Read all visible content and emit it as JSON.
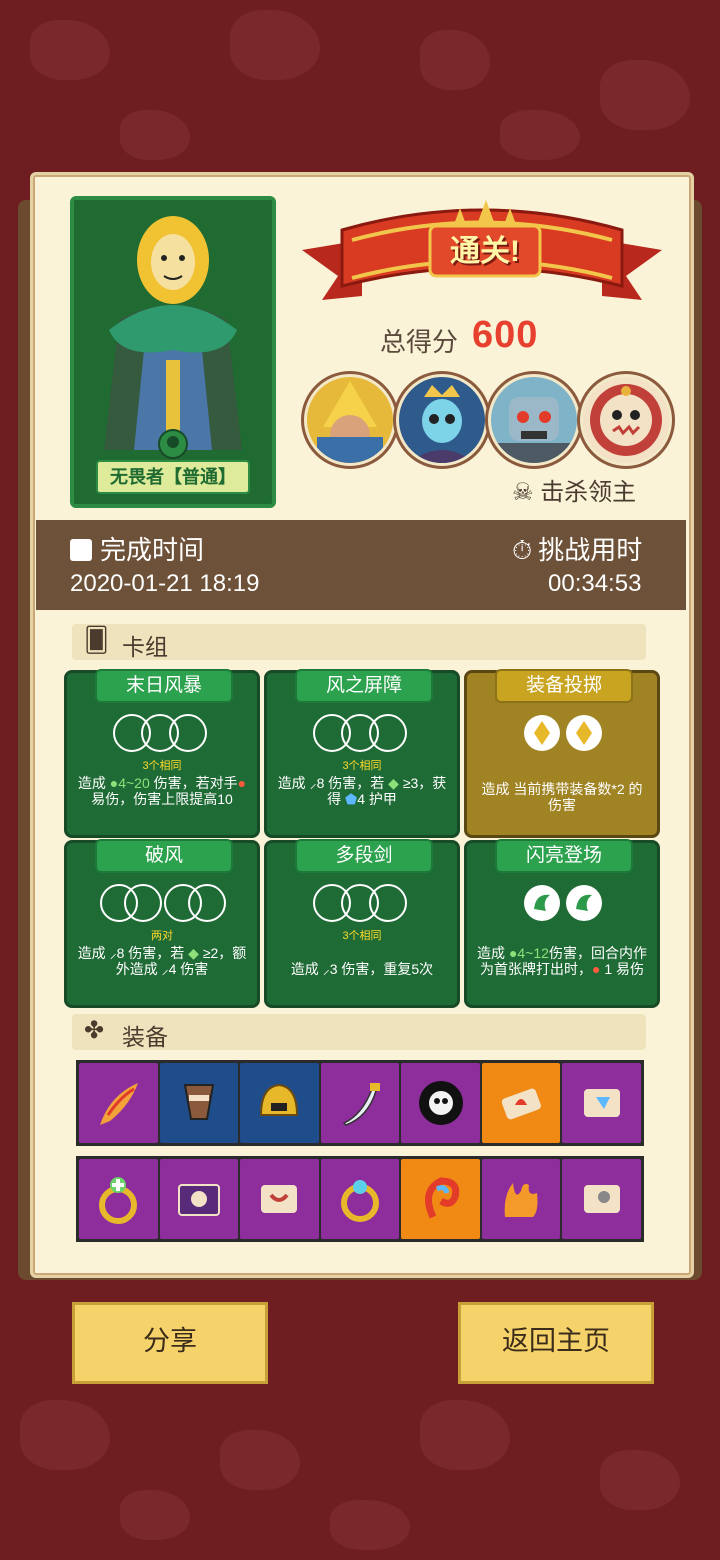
{
  "result": {
    "banner": "通关!",
    "score_label": "总得分",
    "score_value": "600",
    "kill_label": "击杀领主"
  },
  "hero": {
    "name": "无畏者【普通】"
  },
  "time": {
    "finish_label": "完成时间",
    "finish_value": "2020-01-21 18:19",
    "elapsed_label": "挑战用时",
    "elapsed_value": "00:34:53"
  },
  "deck": {
    "title": "卡组",
    "cards": [
      {
        "name": "末日风暴",
        "combo": "3个相同",
        "desc_a": "造成",
        "desc_b": "4~20",
        "desc_c": "伤害，若对手",
        "desc_d": "易伤，伤害上限提高10",
        "color": "green"
      },
      {
        "name": "风之屏障",
        "combo": "3个相同",
        "desc_a": "造成",
        "desc_b": "8 伤害，若",
        "desc_c": "≥3，获得",
        "desc_d": "4 护甲",
        "color": "green"
      },
      {
        "name": "装备投掷",
        "combo": "",
        "desc_a": "造成 当前携带装备数*2 的伤害",
        "desc_b": "",
        "desc_c": "",
        "desc_d": "",
        "color": "yellow"
      },
      {
        "name": "破风",
        "combo": "两对",
        "desc_a": "造成",
        "desc_b": "8 伤害，若",
        "desc_c": "≥2，额外造成",
        "desc_d": "4 伤害",
        "color": "green"
      },
      {
        "name": "多段剑",
        "combo": "3个相同",
        "desc_a": "造成",
        "desc_b": "3 伤害，重复5次",
        "desc_c": "",
        "desc_d": "",
        "color": "green"
      },
      {
        "name": "闪亮登场",
        "combo": "",
        "desc_a": "造成",
        "desc_b": "4~12",
        "desc_c": "伤害，回合内作为首张牌打出时，",
        "desc_d": "1 易伤",
        "color": "green"
      }
    ]
  },
  "equipment": {
    "title": "装备",
    "row1": [
      {
        "icon": "flame-feather-icon",
        "color": "purple"
      },
      {
        "icon": "goblet-icon",
        "color": "blue"
      },
      {
        "icon": "golden-helmet-icon",
        "color": "blue"
      },
      {
        "icon": "dagger-icon",
        "color": "purple"
      },
      {
        "icon": "dark-skull-icon",
        "color": "purple"
      },
      {
        "icon": "fire-scroll-icon",
        "color": "orange"
      },
      {
        "icon": "blue-scroll-icon",
        "color": "purple"
      }
    ],
    "row2": [
      {
        "icon": "healing-ring-icon",
        "color": "purple"
      },
      {
        "icon": "skull-book-icon",
        "color": "purple"
      },
      {
        "icon": "red-scroll-icon",
        "color": "purple"
      },
      {
        "icon": "gem-ring-icon",
        "color": "purple"
      },
      {
        "icon": "swirl-icon",
        "color": "orange"
      },
      {
        "icon": "flame-bundle-icon",
        "color": "purple"
      },
      {
        "icon": "skull-scroll-icon",
        "color": "purple"
      }
    ]
  },
  "buttons": {
    "share": "分享",
    "home": "返回主页"
  }
}
